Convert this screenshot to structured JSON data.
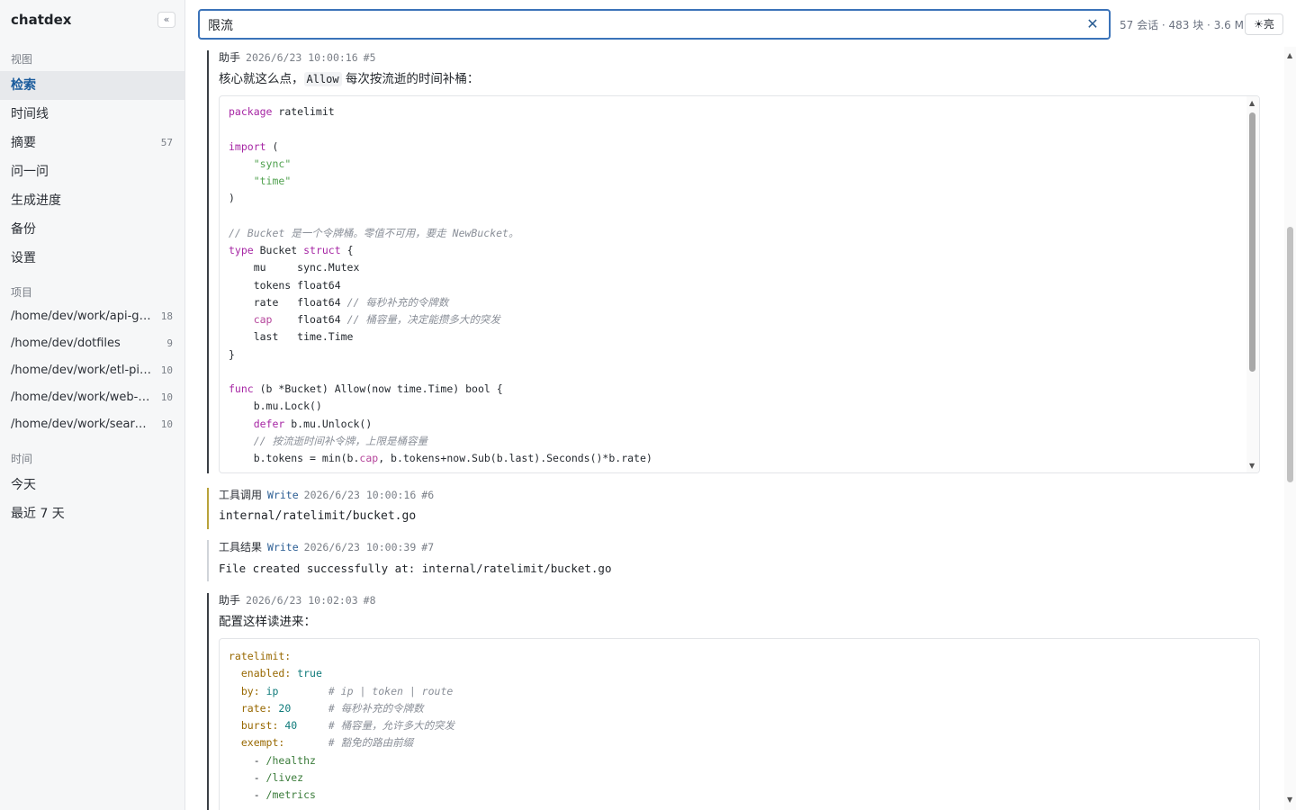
{
  "app": {
    "name": "chatdex",
    "collapse_label": "«"
  },
  "sidebar": {
    "views_label": "视图",
    "views": [
      {
        "label": "检索",
        "count": "",
        "active": true
      },
      {
        "label": "时间线",
        "count": ""
      },
      {
        "label": "摘要",
        "count": "57"
      },
      {
        "label": "问一问",
        "count": ""
      },
      {
        "label": "生成进度",
        "count": ""
      },
      {
        "label": "备份",
        "count": ""
      },
      {
        "label": "设置",
        "count": ""
      }
    ],
    "projects_label": "项目",
    "projects": [
      {
        "label": "/home/dev/work/api-ga...",
        "count": "18"
      },
      {
        "label": "/home/dev/dotfiles",
        "count": "9"
      },
      {
        "label": "/home/dev/work/etl-pip...",
        "count": "10"
      },
      {
        "label": "/home/dev/work/web-c...",
        "count": "10"
      },
      {
        "label": "/home/dev/work/search...",
        "count": "10"
      }
    ],
    "time_label": "时间",
    "time": [
      {
        "label": "今天"
      },
      {
        "label": "最近 7 天"
      }
    ]
  },
  "search": {
    "value": "限流",
    "clear_label": "✕"
  },
  "stats": "57 会话 · 483 块 · 3.6 MB",
  "theme_button": "☀亮",
  "messages": [
    {
      "role": "助手",
      "time": "2026/6/23 10:00:16",
      "index": "#5",
      "text_before": "核心就这么点，",
      "text_code": "Allow",
      "text_after": " 每次按流逝的时间补桶：",
      "code_lines": [
        "package ratelimit",
        "",
        "import (",
        "    \"sync\"",
        "    \"time\"",
        ")",
        "",
        "// Bucket 是一个令牌桶。零值不可用，要走 NewBucket。",
        "type Bucket struct {",
        "    mu     sync.Mutex",
        "    tokens float64",
        "    rate   float64 // 每秒补充的令牌数",
        "    cap    float64 // 桶容量，决定能攒多大的突发",
        "    last   time.Time",
        "}",
        "",
        "func (b *Bucket) Allow(now time.Time) bool {",
        "    b.mu.Lock()",
        "    defer b.mu.Unlock()",
        "    // 按流逝时间补令牌，上限是桶容量",
        "    b.tokens = min(b.cap, b.tokens+now.Sub(b.last).Seconds()*b.rate)"
      ]
    },
    {
      "role": "工具调用",
      "tool": "Write",
      "time": "2026/6/23 10:00:16",
      "index": "#6",
      "text": "internal/ratelimit/bucket.go"
    },
    {
      "role": "工具结果",
      "tool": "Write",
      "time": "2026/6/23 10:00:39",
      "index": "#7",
      "text": "File created successfully at: internal/ratelimit/bucket.go"
    },
    {
      "role": "助手",
      "time": "2026/6/23 10:02:03",
      "index": "#8",
      "text": "配置这样读进来：",
      "code_lines": [
        "ratelimit:",
        "  enabled: true",
        "  by: ip        # ip | token | route",
        "  rate: 20      # 每秒补充的令牌数",
        "  burst: 40     # 桶容量，允许多大的突发",
        "  exempt:       # 豁免的路由前缀",
        "    - /healthz",
        "    - /livez",
        "    - /metrics"
      ]
    }
  ]
}
